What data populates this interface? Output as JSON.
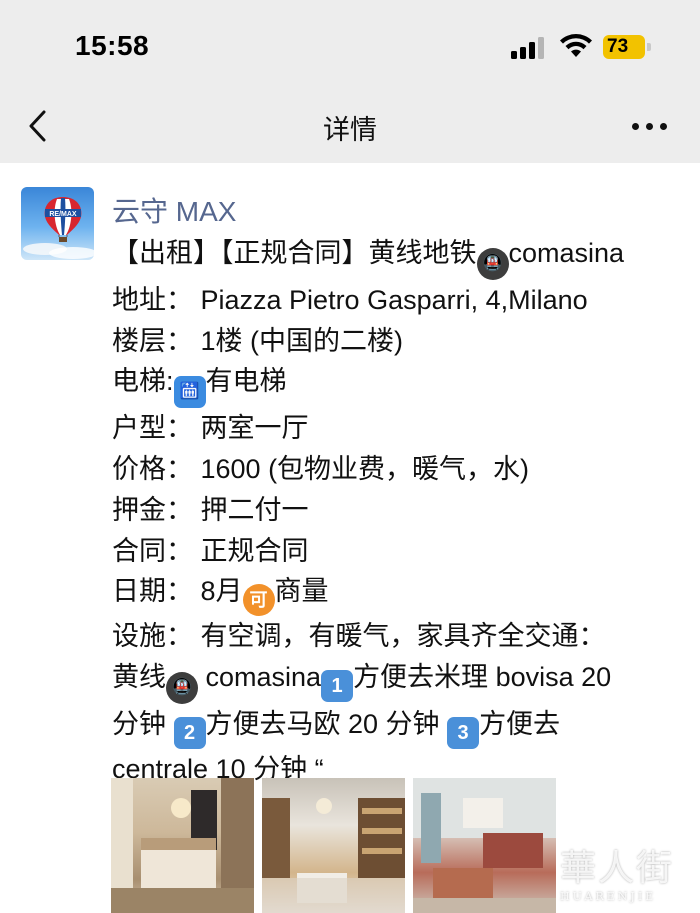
{
  "status_bar": {
    "time": "15:58",
    "battery": "73"
  },
  "nav": {
    "title": "详情"
  },
  "post": {
    "author": "云守 MAX",
    "avatar_text": "RE/MAX",
    "lines": {
      "l1_a": "【出租】【正规合同】黄线地铁",
      "l1_b": "comasina",
      "l2": "地址： Piazza Pietro Gasparri, 4,Milano",
      "l3": "楼层： 1楼 (中国的二楼)",
      "l4_a": "电梯:",
      "l4_b": "有电梯",
      "l5": "户型： 两室一厅",
      "l6": "价格： 1600 (包物业费，暖气，水)",
      "l7": "押金： 押二付一",
      "l8": "合同： 正规合同",
      "l9_a": "日期： 8月",
      "l9_b": "商量",
      "l10": "设施： 有空调，有暖气，家具齐全交通：",
      "l11_a": "黄线",
      "l11_b": " comasina",
      "l11_c": "方便去米理 bovisa 20",
      "l12_a": "分钟 ",
      "l12_b": "方便去马欧 20 分钟 ",
      "l12_c": "方便去",
      "l13": "centrale 10 分钟 “"
    },
    "emoji": {
      "metro": "🚇",
      "elevator": "🛗",
      "ke": "可",
      "n1": "1",
      "n2": "2",
      "n3": "3"
    }
  },
  "watermark": {
    "big": "華人街",
    "small": "HUARENJIE"
  }
}
